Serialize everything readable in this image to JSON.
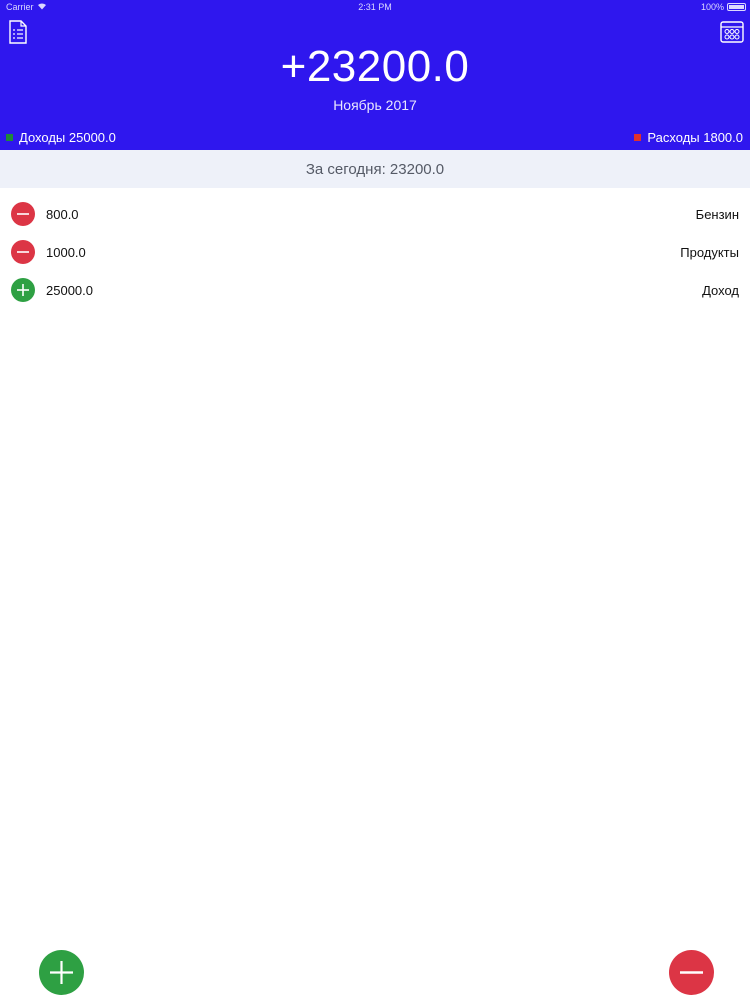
{
  "status_bar": {
    "carrier": "Carrier",
    "time": "2:31 PM",
    "battery": "100%"
  },
  "header": {
    "balance": "+23200.0",
    "period": "Ноябрь 2017",
    "income_label": "Доходы 25000.0",
    "expense_label": "Расходы 1800.0",
    "icons": {
      "left": "report-icon",
      "right": "calendar-grid-icon"
    }
  },
  "today": {
    "label": "За сегодня: 23200.0"
  },
  "transactions": [
    {
      "type": "expense",
      "amount": "800.0",
      "category": "Бензин"
    },
    {
      "type": "expense",
      "amount": "1000.0",
      "category": "Продукты"
    },
    {
      "type": "income",
      "amount": "25000.0",
      "category": "Доход"
    }
  ],
  "colors": {
    "header_bg": "#2f17ee",
    "income": "#2ea043",
    "expense": "#dc3545",
    "income_legend": "#1f8a3a",
    "expense_legend": "#e0312d",
    "today_bg": "#eef1f9"
  }
}
